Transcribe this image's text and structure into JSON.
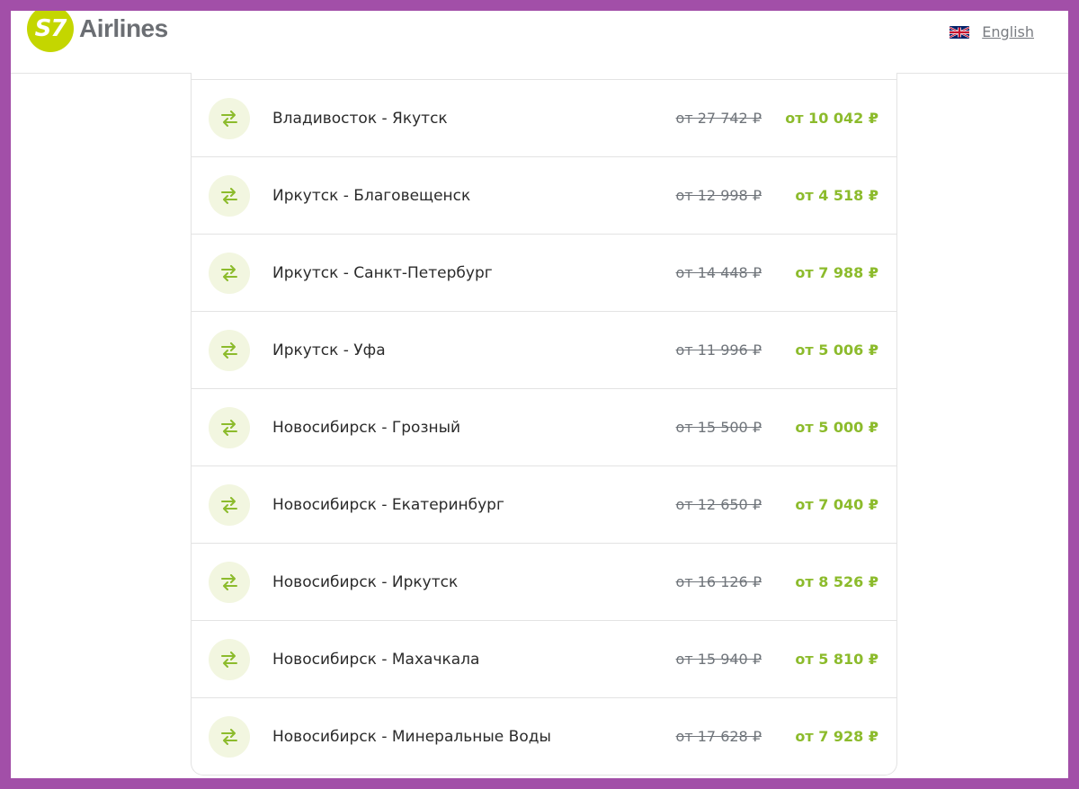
{
  "header": {
    "logo_mark": "S7",
    "logo_text": "Airlines",
    "language_label": "English"
  },
  "colors": {
    "brand_green": "#c4d600",
    "price_green": "#8cbb2c",
    "icon_bg": "#f2f6e0",
    "frame_border": "#a24fa8"
  },
  "routes": [
    {
      "route": "Владивосток - Якутск",
      "old_price": "от 27 742 ₽",
      "new_price": "от 10 042 ₽"
    },
    {
      "route": "Иркутск - Благовещенск",
      "old_price": "от 12 998 ₽",
      "new_price": "от 4 518 ₽"
    },
    {
      "route": "Иркутск - Санкт-Петербург",
      "old_price": "от 14 448 ₽",
      "new_price": "от 7 988 ₽"
    },
    {
      "route": "Иркутск - Уфа",
      "old_price": "от 11 996 ₽",
      "new_price": "от 5 006 ₽"
    },
    {
      "route": "Новосибирск - Грозный",
      "old_price": "от 15 500 ₽",
      "new_price": "от 5 000 ₽"
    },
    {
      "route": "Новосибирск - Екатеринбург",
      "old_price": "от 12 650 ₽",
      "new_price": "от 7 040 ₽"
    },
    {
      "route": "Новосибирск - Иркутск",
      "old_price": "от 16 126 ₽",
      "new_price": "от 8 526 ₽"
    },
    {
      "route": "Новосибирск - Махачкала",
      "old_price": "от 15 940 ₽",
      "new_price": "от 5 810 ₽"
    },
    {
      "route": "Новосибирск - Минеральные Воды",
      "old_price": "от 17 628 ₽",
      "new_price": "от 7 928 ₽"
    }
  ],
  "icons": {
    "row_icon": "round-trip-arrows-icon",
    "flag_icon": "uk-flag-icon"
  }
}
